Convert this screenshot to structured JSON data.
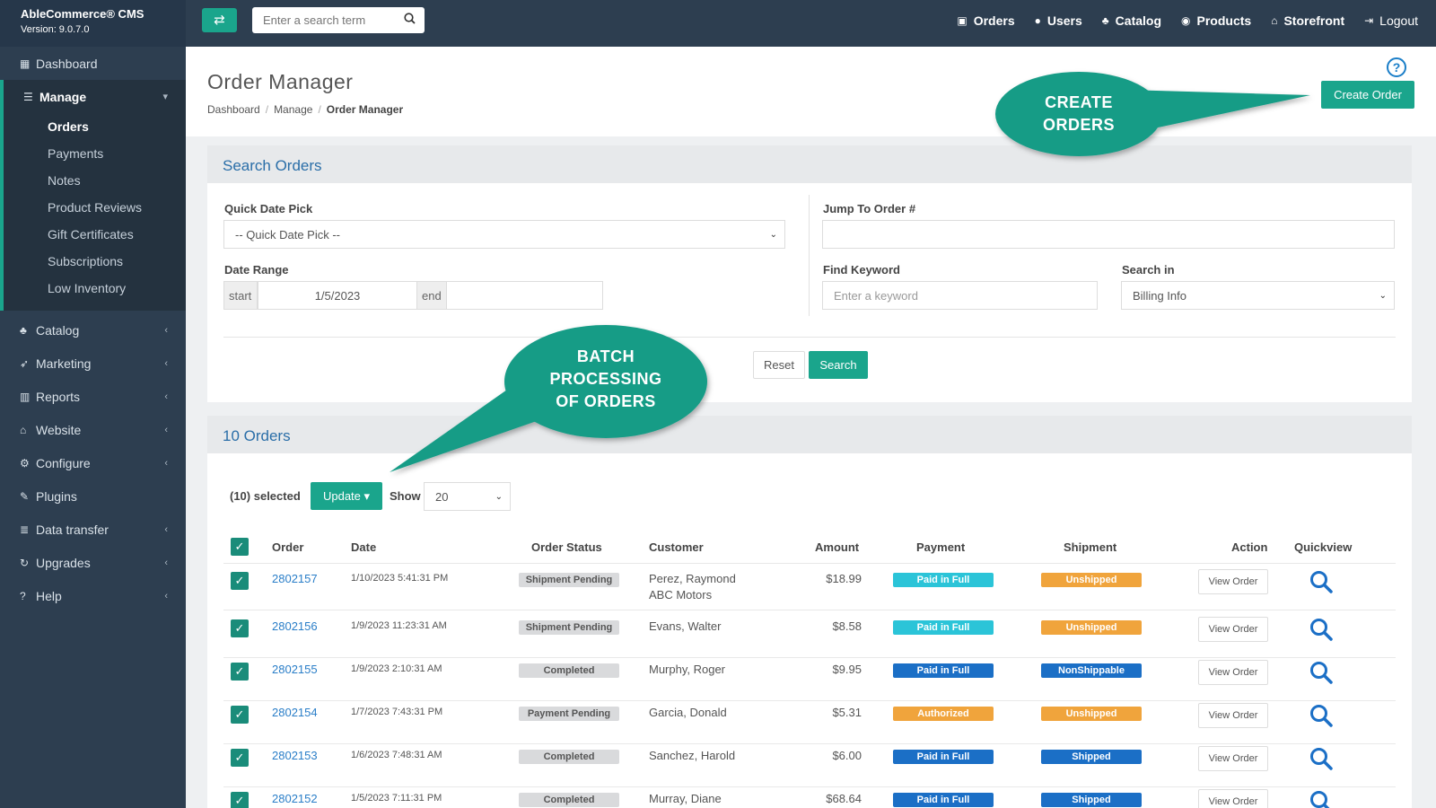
{
  "brand": {
    "name": "AbleCommerce® CMS",
    "version": "Version: 9.0.7.0"
  },
  "sidebar": {
    "dashboard": "Dashboard",
    "manage": "Manage",
    "manage_items": [
      "Orders",
      "Payments",
      "Notes",
      "Product Reviews",
      "Gift Certificates",
      "Subscriptions",
      "Low Inventory"
    ],
    "sections": [
      {
        "label": "Catalog",
        "icon": "sitemap-icon"
      },
      {
        "label": "Marketing",
        "icon": "rocket-icon"
      },
      {
        "label": "Reports",
        "icon": "bar-chart-icon"
      },
      {
        "label": "Website",
        "icon": "home-icon"
      },
      {
        "label": "Configure",
        "icon": "gears-icon"
      },
      {
        "label": "Plugins",
        "icon": "puzzle-icon"
      },
      {
        "label": "Data transfer",
        "icon": "database-icon"
      },
      {
        "label": "Upgrades",
        "icon": "refresh-icon"
      },
      {
        "label": "Help",
        "icon": "question-icon"
      }
    ]
  },
  "topbar": {
    "search_placeholder": "Enter a search term",
    "nav": [
      "Orders",
      "Users",
      "Catalog",
      "Products",
      "Storefront",
      "Logout"
    ]
  },
  "header": {
    "title": "Order Manager",
    "breadcrumb": [
      "Dashboard",
      "Manage",
      "Order Manager"
    ],
    "create_button": "Create Order"
  },
  "search_panel": {
    "title": "Search Orders",
    "quick_date_label": "Quick Date Pick",
    "quick_date_value": "-- Quick Date Pick --",
    "date_range_label": "Date Range",
    "start_label": "start",
    "start_value": "1/5/2023",
    "end_label": "end",
    "jump_label": "Jump To Order #",
    "keyword_label": "Find Keyword",
    "keyword_placeholder": "Enter a keyword",
    "search_in_label": "Search in",
    "search_in_value": "Billing Info",
    "reset_button": "Reset",
    "search_button": "Search"
  },
  "orders_panel": {
    "title": "10 Orders",
    "selected_text": "(10) selected",
    "update_button": "Update ▾",
    "show_label": "Show",
    "show_value": "20",
    "columns": [
      "Order",
      "Date",
      "Order Status",
      "Customer",
      "Amount",
      "Payment",
      "Shipment",
      "Action",
      "Quickview"
    ],
    "view_label": "View Order",
    "rows": [
      {
        "order": "2802157",
        "date": "1/10/2023 5:41:31 PM",
        "status": "Shipment Pending",
        "customer": "Perez, Raymond",
        "customer2": "ABC Motors",
        "amount": "$18.99",
        "payment": "Paid in Full",
        "shipment": "Unshipped"
      },
      {
        "order": "2802156",
        "date": "1/9/2023 11:23:31 AM",
        "status": "Shipment Pending",
        "customer": "Evans, Walter",
        "customer2": "",
        "amount": "$8.58",
        "payment": "Paid in Full",
        "shipment": "Unshipped"
      },
      {
        "order": "2802155",
        "date": "1/9/2023 2:10:31 AM",
        "status": "Completed",
        "customer": "Murphy, Roger",
        "customer2": "",
        "amount": "$9.95",
        "payment": "Paid in Full",
        "shipment": "NonShippable"
      },
      {
        "order": "2802154",
        "date": "1/7/2023 7:43:31 PM",
        "status": "Payment Pending",
        "customer": "Garcia, Donald",
        "customer2": "",
        "amount": "$5.31",
        "payment": "Authorized",
        "shipment": "Unshipped"
      },
      {
        "order": "2802153",
        "date": "1/6/2023 7:48:31 AM",
        "status": "Completed",
        "customer": "Sanchez, Harold",
        "customer2": "",
        "amount": "$6.00",
        "payment": "Paid in Full",
        "shipment": "Shipped"
      },
      {
        "order": "2802152",
        "date": "1/5/2023 7:11:31 PM",
        "status": "Completed",
        "customer": "Murray, Diane",
        "customer2": "",
        "amount": "$68.64",
        "payment": "Paid in Full",
        "shipment": "Shipped"
      }
    ]
  },
  "callouts": {
    "create": [
      "CREATE",
      "ORDERS"
    ],
    "batch": [
      "BATCH",
      "PROCESSING",
      "OF ORDERS"
    ]
  },
  "colors": {
    "accent": "#1aa58c",
    "sidebar": "#2d3e50",
    "link": "#2a7ec8"
  }
}
